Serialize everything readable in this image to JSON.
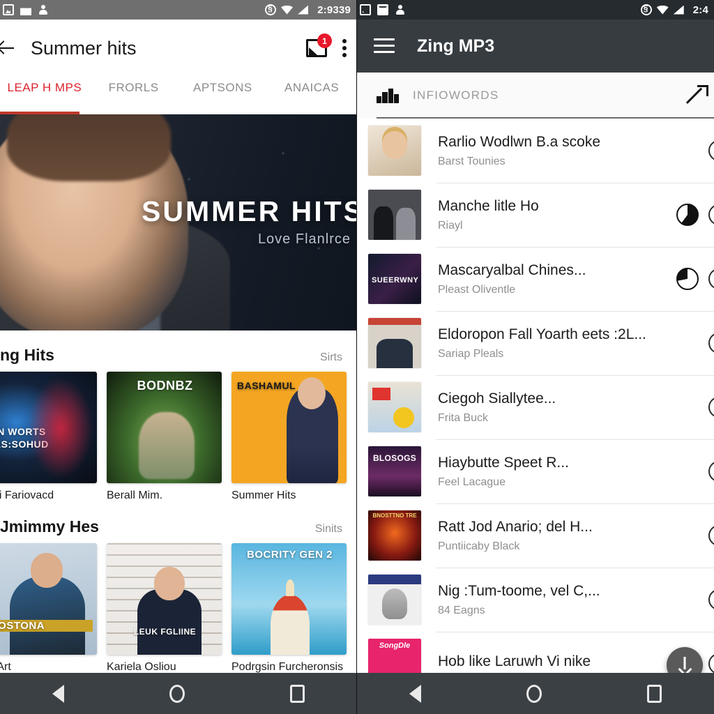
{
  "left": {
    "status": {
      "time": "2:9339",
      "icons": [
        "photo-icon",
        "toolbox-icon",
        "person-icon"
      ],
      "right_icons": [
        "sync-icon",
        "wifi-icon",
        "signal-icon"
      ]
    },
    "toolbar": {
      "back_label": "back-arrow",
      "title": "Summer hits",
      "cast_badge": "1",
      "overflow_label": "more-options"
    },
    "tabs": [
      {
        "label": "LEAP H MPS",
        "active": true
      },
      {
        "label": "FRORLS",
        "active": false
      },
      {
        "label": "APTSONS",
        "active": false
      },
      {
        "label": "ANAICAS",
        "active": false
      }
    ],
    "hero": {
      "title": "SUMMER HITS",
      "subtitle": "Love Flanlrce"
    },
    "sections": [
      {
        "title": "ng Hits",
        "more_label": "Sirts",
        "cards": [
          {
            "label": "orrri Fariovacd",
            "art_text": "SIN WORTS LAS:SOHUD",
            "art": "art-a"
          },
          {
            "label": "Berall Mim.",
            "art_text": "BODNBZ",
            "art": "art-b"
          },
          {
            "label": "Summer Hits",
            "art_text": "BASHAMUL",
            "art": "art-c"
          }
        ]
      },
      {
        "title": "Jmimmy Hes",
        "more_label": "Sinits",
        "cards": [
          {
            "label": "od Art",
            "art_text": "GOSTONA",
            "art": "art-d"
          },
          {
            "label": "Kariela Osliou",
            "art_text": "LEUK FGLIINE",
            "art": "art-e"
          },
          {
            "label": "Podrgsin Furcheronsis",
            "art_text": "BOCRITY GEN 2",
            "art": "art-f"
          }
        ]
      }
    ],
    "navbar": [
      "back-nav-icon",
      "home-nav-icon",
      "recents-nav-icon"
    ]
  },
  "right": {
    "status": {
      "time": "2:4",
      "icons": [
        "cast-icon",
        "mail-icon",
        "person-icon"
      ],
      "right_icons": [
        "sync-icon",
        "wifi-icon",
        "signal-icon"
      ]
    },
    "toolbar": {
      "menu_label": "hamburger-menu",
      "title": "Zing MP3"
    },
    "subheader": {
      "icon": "equalizer-icon",
      "label": "INFIOWORDS",
      "action_icon": "arrow-expand-icon"
    },
    "songs": [
      {
        "title": "Rarlio Wodlwn B.a scoke",
        "artist": "Barst Tounies",
        "art": "sa1",
        "art_text": "",
        "progress": null,
        "download": true
      },
      {
        "title": "Manche litle Ho",
        "artist": "Riayl",
        "art": "sa2",
        "art_text": "",
        "progress": 60,
        "download": true
      },
      {
        "title": "Mascaryalbal Chines...",
        "artist": "Pleast Oliventle",
        "art": "sa3",
        "art_text": "SUEERWNY",
        "progress": 25,
        "download": true
      },
      {
        "title": "Eldoropon Fall Yoarth eets :2L...",
        "artist": "Sariap Pleals",
        "art": "sa4",
        "art_text": "",
        "progress": null,
        "download": true
      },
      {
        "title": "Ciegoh Siallytee...",
        "artist": "Frita Buck",
        "art": "sa5",
        "art_text": "",
        "progress": null,
        "download": true
      },
      {
        "title": "Hiaybutte Speet R...",
        "artist": "Feel Lacague",
        "art": "sa6",
        "art_text": "BLOSOGS",
        "progress": null,
        "download": true
      },
      {
        "title": "Ratt Jod Anario; del H...",
        "artist": "Puntiicaby Black",
        "art": "sa7",
        "art_text": "BNOSTTNO TRE",
        "progress": null,
        "download": true
      },
      {
        "title": "Nig :Tum-toome, vel C,...",
        "artist": "84 Eagns",
        "art": "sa8",
        "art_text": "",
        "progress": null,
        "download": true
      },
      {
        "title": "Hob like Laruwh Vi nike",
        "artist": "",
        "art": "sa9",
        "art_text": "SongDle",
        "progress": null,
        "download": true
      }
    ],
    "fab": {
      "icon": "download-fab-icon"
    },
    "navbar": [
      "back-nav-icon",
      "home-nav-icon",
      "recents-nav-icon"
    ]
  },
  "colors": {
    "accent_red": "#d9232d",
    "badge_red": "#e8192c",
    "toolbar_dark": "#373c41",
    "navbar": "#3b4045"
  }
}
